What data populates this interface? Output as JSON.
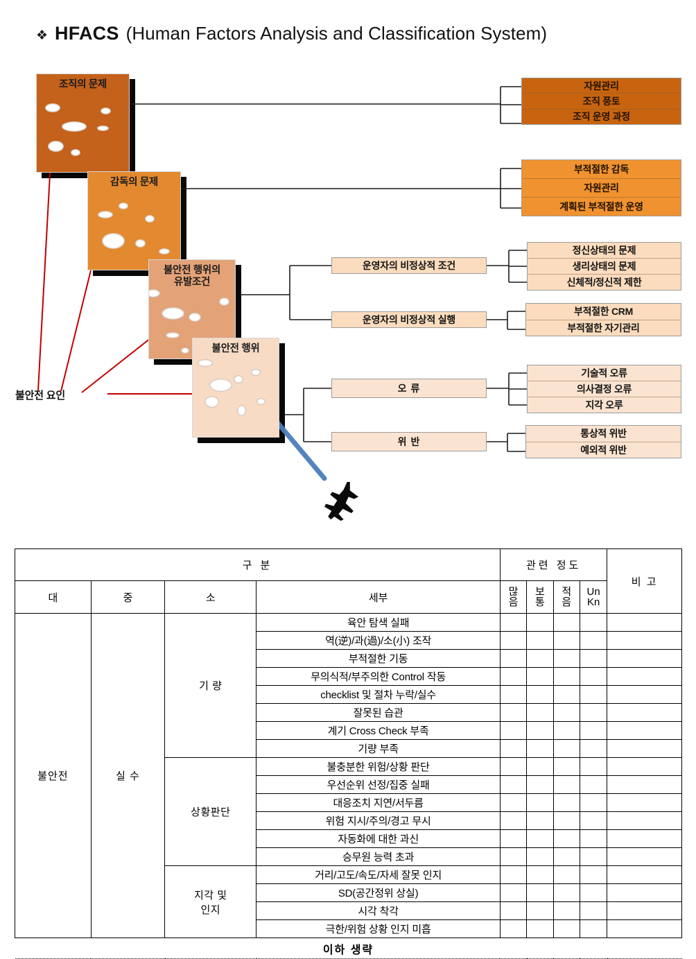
{
  "title": {
    "bullet": "❖",
    "main": "HFACS",
    "sub": "(Human Factors Analysis and Classification System)"
  },
  "diagram": {
    "slices": [
      {
        "label": "조직의 문제",
        "color": "#C4611A"
      },
      {
        "label": "감독의 문제",
        "color": "#E3892F"
      },
      {
        "label": "불안전 행위의\n유발조건",
        "line1": "불안전 행위의",
        "line2": "유발조건",
        "color": "#E4A277"
      },
      {
        "label": "불안전 행위",
        "color": "#F7DBC5"
      }
    ],
    "unsafe_factor_label": "불안전 요인",
    "level1_items": [
      "자원관리",
      "조직 풍토",
      "조직 운영 과정"
    ],
    "level2_items": [
      "부적절한 감독",
      "자원관리",
      "계획된 부적절한 운영"
    ],
    "mid_condition": "운영자의 비정상적 조건",
    "mid_condition_items": [
      "정신상태의 문제",
      "생리상태의 문제",
      "신체적/정신적 제한"
    ],
    "mid_practice": "운영자의 비정상적 실행",
    "mid_practice_items": [
      "부적절한 CRM",
      "부적절한 자기관리"
    ],
    "mid_error": "오 류",
    "mid_error_items": [
      "기술적 오류",
      "의사결정 오류",
      "지각 오루"
    ],
    "mid_violation": "위 반",
    "mid_violation_items": [
      "통상적 위반",
      "예외적 위반"
    ],
    "colors": {
      "level1": "#C8640F",
      "level2": "#F0922F",
      "level3": "#FBDCBE",
      "level4": "#FAE3D0",
      "pointer": "#C00000",
      "arrow": "#4A7EBB",
      "connector": "#1a1a1a"
    },
    "aircraft_icon": "aircraft-silhouette"
  },
  "table": {
    "header": {
      "group": "구 분",
      "relevance": "관련 정도",
      "remark": "비 고",
      "cols": [
        "대",
        "중",
        "소",
        "세부"
      ],
      "marks": [
        {
          "l1": "많",
          "l2": "음"
        },
        {
          "l1": "보",
          "l2": "통"
        },
        {
          "l1": "적",
          "l2": "음"
        },
        {
          "l1": "Un",
          "l2": "Kn"
        }
      ]
    },
    "major": "불안전",
    "medium": "실  수",
    "groups": [
      {
        "name": "기 량",
        "name_lines": [
          "기 량"
        ],
        "rows": [
          "육안 탐색 실패",
          "역(逆)/과(過)/소(小) 조작",
          "부적절한 기동",
          "무의식적/부주의한 Control 작동",
          "checklist 및 절차 누락/실수",
          "잘못된 습관",
          "계기 Cross Check 부족",
          "기량 부족"
        ]
      },
      {
        "name": "상황판단",
        "name_lines": [
          "상황판단"
        ],
        "rows": [
          "불충분한 위험/상황 판단",
          "우선순위 선정/집중 실패",
          "대응조치 지연/서두름",
          "위험 지시/주의/경고 무시",
          "자동화에 대한 과신",
          "승무원 능력 초과"
        ]
      },
      {
        "name": "지각 및 인지",
        "name_lines": [
          "지각 및",
          "인지"
        ],
        "rows": [
          "거리/고도/속도/자세 잘못 인지",
          "SD(공간정위 상실)",
          "시각 착각",
          "극한/위험 상황 인지 미흡"
        ]
      }
    ],
    "footer": "이하 생략"
  }
}
